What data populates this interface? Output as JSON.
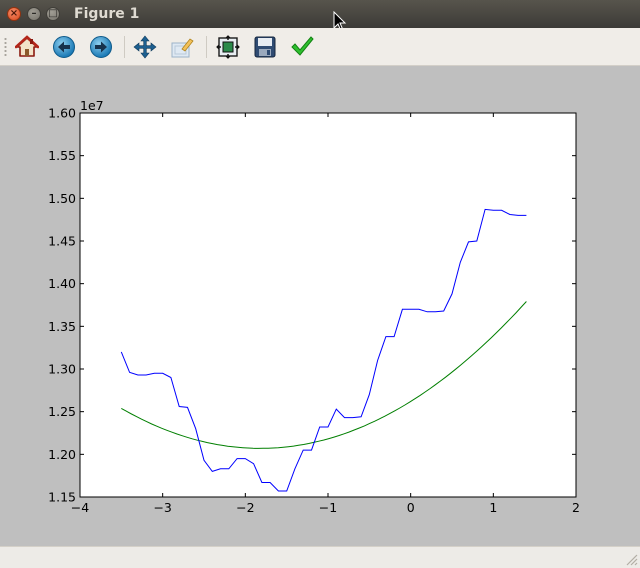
{
  "window": {
    "title": "Figure 1"
  },
  "toolbar": {
    "icons": [
      "home-icon",
      "back-arrow-icon",
      "forward-arrow-icon",
      "pan-icon",
      "zoom-icon",
      "subplots-icon",
      "save-icon",
      "edit-check-icon"
    ]
  },
  "chart_data": {
    "type": "line",
    "title": "",
    "xlabel": "",
    "ylabel": "",
    "y_offset_label": "1e7",
    "xlim": [
      -4,
      2
    ],
    "ylim": [
      1.15,
      1.6
    ],
    "xticks": [
      -4,
      -3,
      -2,
      -1,
      0,
      1,
      2
    ],
    "xtick_labels": [
      "−4",
      "−3",
      "−2",
      "−1",
      "0",
      "1",
      "2"
    ],
    "yticks": [
      1.15,
      1.2,
      1.25,
      1.3,
      1.35,
      1.4,
      1.45,
      1.5,
      1.55,
      1.6
    ],
    "ytick_labels": [
      "1.15",
      "1.20",
      "1.25",
      "1.30",
      "1.35",
      "1.40",
      "1.45",
      "1.50",
      "1.55",
      "1.60"
    ],
    "grid": false,
    "series": [
      {
        "color": "#0000ff",
        "x": [
          -3.5,
          -3.4,
          -3.3,
          -3.2,
          -3.1,
          -3.0,
          -2.9,
          -2.8,
          -2.7,
          -2.6,
          -2.5,
          -2.4,
          -2.3,
          -2.2,
          -2.1,
          -2.0,
          -1.9,
          -1.8,
          -1.7,
          -1.6,
          -1.5,
          -1.4,
          -1.3,
          -1.2,
          -1.1,
          -1.0,
          -0.9,
          -0.8,
          -0.7,
          -0.6,
          -0.5,
          -0.4,
          -0.3,
          -0.2,
          -0.1,
          0.0,
          0.1,
          0.2,
          0.3,
          0.4,
          0.5,
          0.6,
          0.7,
          0.8,
          0.9,
          1.0,
          1.1,
          1.2,
          1.3,
          1.4
        ],
        "y": [
          1.32,
          1.296,
          1.293,
          1.293,
          1.295,
          1.295,
          1.29,
          1.256,
          1.255,
          1.23,
          1.193,
          1.18,
          1.183,
          1.183,
          1.195,
          1.195,
          1.189,
          1.167,
          1.167,
          1.157,
          1.157,
          1.183,
          1.205,
          1.205,
          1.232,
          1.232,
          1.253,
          1.243,
          1.243,
          1.244,
          1.27,
          1.31,
          1.338,
          1.338,
          1.37,
          1.37,
          1.37,
          1.367,
          1.367,
          1.368,
          1.388,
          1.425,
          1.449,
          1.45,
          1.487,
          1.486,
          1.486,
          1.481,
          1.48,
          1.48
        ]
      },
      {
        "color": "#007f00",
        "quadratic": {
          "a": 0.0166,
          "h": -1.82,
          "k": 1.207
        },
        "x_range": [
          -3.5,
          1.4
        ]
      }
    ]
  }
}
